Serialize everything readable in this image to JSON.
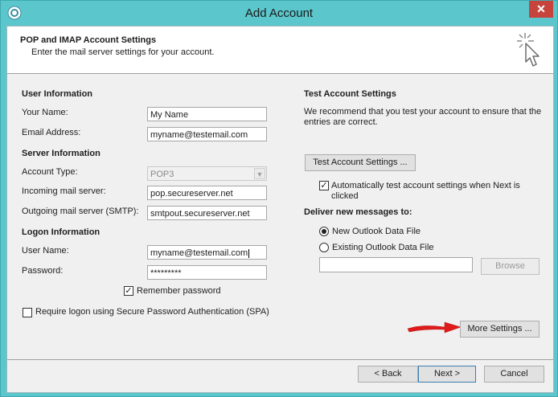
{
  "window": {
    "title": "Add Account",
    "close_label": "✕"
  },
  "header": {
    "title": "POP and IMAP Account Settings",
    "subtitle": "Enter the mail server settings for your account."
  },
  "user_info": {
    "heading": "User Information",
    "name_label": "Your Name:",
    "name_value": "My Name",
    "email_label": "Email Address:",
    "email_value": "myname@testemail.com"
  },
  "server_info": {
    "heading": "Server Information",
    "account_type_label": "Account Type:",
    "account_type_value": "POP3",
    "incoming_label": "Incoming mail server:",
    "incoming_value": "pop.secureserver.net",
    "outgoing_label": "Outgoing mail server (SMTP):",
    "outgoing_value": "smtpout.secureserver.net"
  },
  "logon_info": {
    "heading": "Logon Information",
    "username_label": "User Name:",
    "username_value": "myname@testemail.com",
    "password_label": "Password:",
    "password_value": "*********",
    "remember_label": "Remember password",
    "remember_checked": true,
    "spa_label": "Require logon using Secure Password Authentication (SPA)",
    "spa_checked": false
  },
  "test_settings": {
    "heading": "Test Account Settings",
    "description": "We recommend that you test your account to ensure that the entries are correct.",
    "test_button": "Test Account Settings ...",
    "auto_test_label": "Automatically test account settings when Next is clicked",
    "auto_test_checked": true
  },
  "deliver": {
    "heading": "Deliver new messages to:",
    "new_file_label": "New Outlook Data File",
    "existing_file_label": "Existing Outlook Data File",
    "selected": "new",
    "existing_path_value": "",
    "browse_button": "Browse"
  },
  "more_settings_button": "More Settings ...",
  "footer": {
    "back_button": "< Back",
    "next_button": "Next >",
    "cancel_button": "Cancel"
  },
  "colors": {
    "titlebar": "#5bc6cc",
    "close_button": "#c7443d",
    "annotation_arrow": "#e01b1b",
    "dialog_background": "#f0f0f0"
  },
  "icons": [
    "outlook-app-icon",
    "wizard-cursor-icon",
    "checkmark-icon",
    "red-arrow-icon"
  ]
}
